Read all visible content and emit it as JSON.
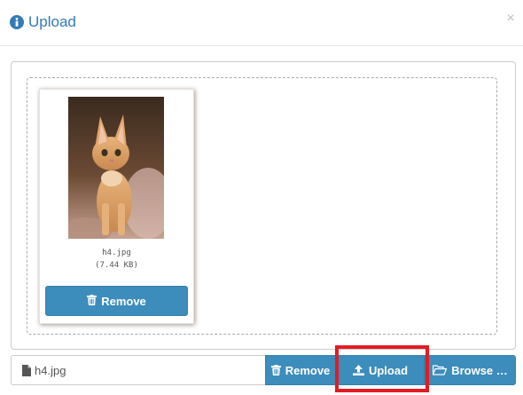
{
  "header": {
    "title": "Upload",
    "close_label": "×"
  },
  "preview": {
    "file_name": "h4.jpg",
    "file_size": "(7.44 KB)",
    "remove_label": "Remove"
  },
  "file_input": {
    "caption": "h4.jpg",
    "remove_label": "Remove",
    "upload_label": "Upload",
    "browse_label": "Browse …"
  },
  "icons": {
    "title": "info-circle-icon",
    "caption": "file-icon",
    "remove": "trash-icon",
    "upload": "upload-icon",
    "browse": "folder-open-icon"
  },
  "colors": {
    "accent": "#337ab7",
    "button": "#3c8dbc",
    "highlight": "#e31b23"
  }
}
